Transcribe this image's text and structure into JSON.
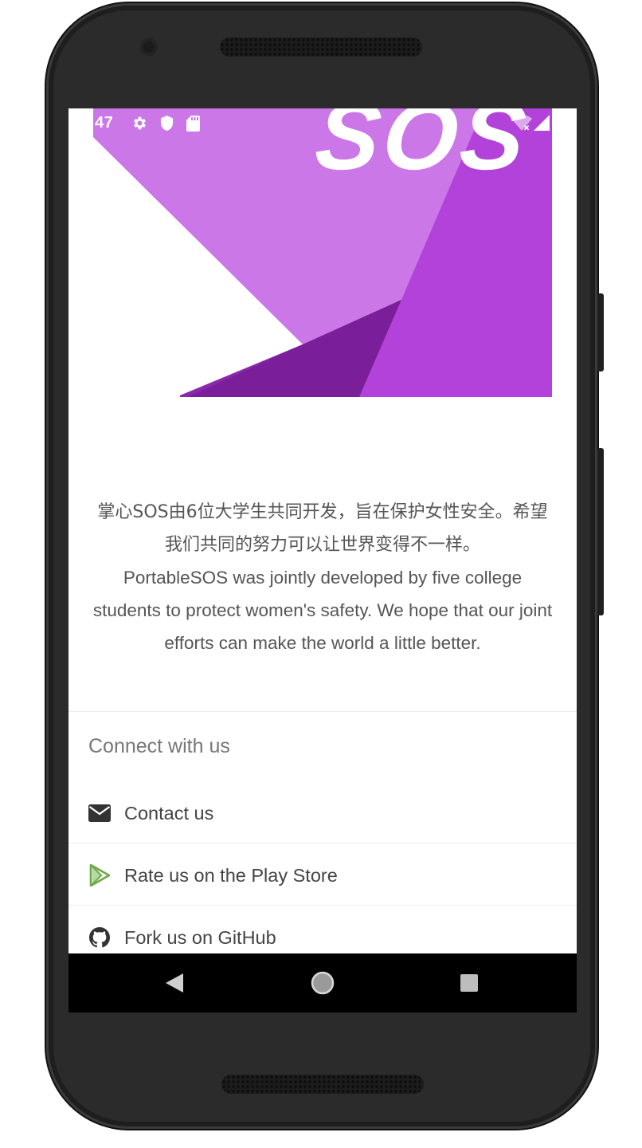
{
  "status_bar": {
    "time": ":47",
    "icons": [
      "settings-gear-icon",
      "shield-icon",
      "sd-card-icon",
      "wifi-icon",
      "signal-icon"
    ]
  },
  "banner": {
    "logo_text": "SOS",
    "colors": {
      "light_purple": "#CB77E8",
      "mid_purple": "#B242D9",
      "dark_purple": "#7B1E9A"
    }
  },
  "about": {
    "chinese_text": "掌心SOS由6位大学生共同开发，旨在保护女性安全。希望我们共同的努力可以让世界变得不一样。",
    "english_text": "PortableSOS was jointly developed by five college students to protect women's safety. We hope that our joint efforts can make the world a little better."
  },
  "connect": {
    "title": "Connect with us",
    "items": [
      {
        "label": "Contact us",
        "icon": "envelope-icon"
      },
      {
        "label": "Rate us on the Play Store",
        "icon": "play-store-icon"
      },
      {
        "label": "Fork us on GitHub",
        "icon": "github-icon"
      }
    ]
  },
  "nav_bar": {
    "buttons": [
      "back-icon",
      "home-icon",
      "recents-icon"
    ]
  }
}
